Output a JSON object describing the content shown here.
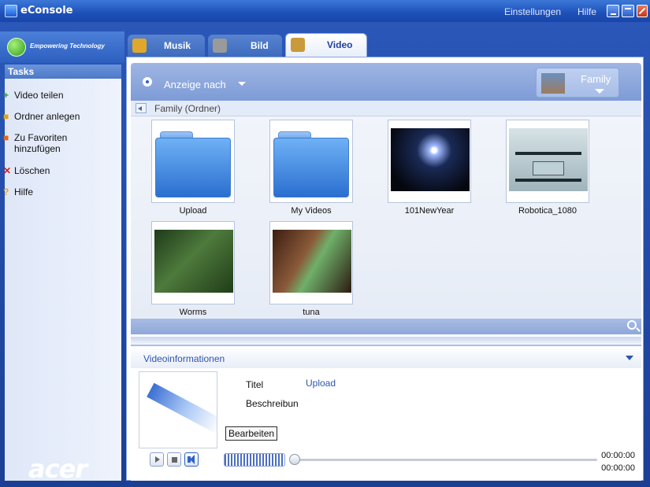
{
  "window": {
    "title": "eConsole",
    "settings": "Einstellungen",
    "help": "Hilfe"
  },
  "brand": {
    "tagline": "Empowering Technology",
    "logo": "acer"
  },
  "sidebar": {
    "header": "Tasks",
    "items": [
      {
        "label": "Video teilen",
        "icon": "plus-icon"
      },
      {
        "label": "Ordner anlegen",
        "icon": "new-folder-icon"
      },
      {
        "label": "Zu Favoriten hinzufügen",
        "icon": "favorites-icon"
      },
      {
        "label": "Löschen",
        "icon": "delete-icon"
      },
      {
        "label": "Hilfe",
        "icon": "help-icon"
      }
    ]
  },
  "tabs": [
    {
      "label": "Musik",
      "icon": "music-icon"
    },
    {
      "label": "Bild",
      "icon": "picture-icon"
    },
    {
      "label": "Video",
      "icon": "video-icon",
      "active": true
    }
  ],
  "toolbar": {
    "sort_label": "Anzeige nach",
    "album_label": "Family"
  },
  "breadcrumb": "Family (Ordner)",
  "items": [
    {
      "name": "Upload",
      "type": "folder"
    },
    {
      "name": "My Videos",
      "type": "folder"
    },
    {
      "name": "101NewYear",
      "type": "video"
    },
    {
      "name": "Robotica_1080",
      "type": "video"
    },
    {
      "name": "Worms",
      "type": "video"
    },
    {
      "name": "tuna",
      "type": "video"
    }
  ],
  "info": {
    "header": "Videoinformationen",
    "title_label": "Titel",
    "title_value": "Upload",
    "desc_label": "Beschreibun",
    "edit_button": "Bearbeiten"
  },
  "player": {
    "elapsed": "00:00:00",
    "total": "00:00:00"
  },
  "colors": {
    "accent": "#2f55ad",
    "titlebar": "#1d50b8",
    "sidebar_bg": "#e6edf9"
  }
}
